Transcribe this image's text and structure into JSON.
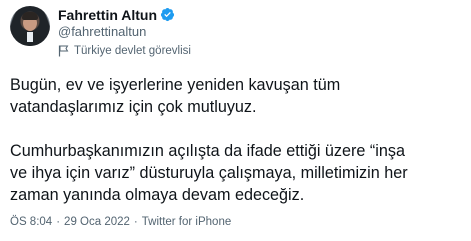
{
  "author": {
    "display_name": "Fahrettin Altun",
    "handle": "@fahrettinaltun",
    "verified": true,
    "account_label": "Türkiye devlet görevlisi"
  },
  "tweet": {
    "paragraphs": [
      "Bugün, ev ve işyerlerine yeniden kavuşan tüm\nvatandaşlarımız için çok mutluyuz.",
      "Cumhurbaşkanımızın açılışta da ifade ettiği üzere “inşa\nve ihya için varız” düsturuyla çalışmaya, milletimizin her\nzaman yanında olmaya devam edeceğiz."
    ]
  },
  "meta": {
    "time": "ÖS 8:04",
    "date": "29 Oca 2022",
    "client": "Twitter for iPhone",
    "separator": "·"
  },
  "colors": {
    "verified_badge": "#1d9bf0",
    "secondary_text": "#536471",
    "primary_text": "#0f1419"
  },
  "icons": {
    "verified": "verified-badge-icon",
    "account_label": "flag-icon"
  }
}
